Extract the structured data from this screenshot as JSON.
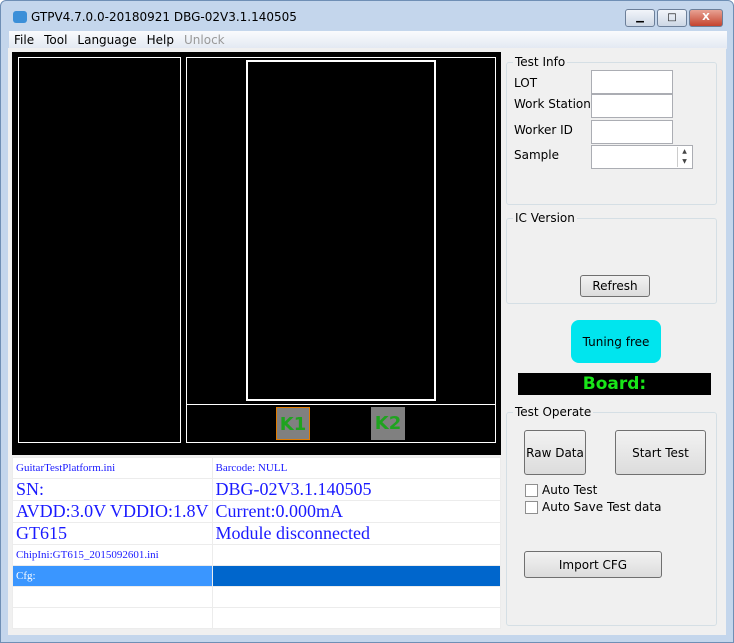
{
  "window": {
    "title": "GTPV4.7.0.0-20180921  DBG-02V3.1.140505",
    "minimize": "▁",
    "maximize": "□",
    "close": "X"
  },
  "menu": [
    "File",
    "Tool",
    "Language",
    "Help",
    "Unlock"
  ],
  "keys": [
    "K1",
    "K2"
  ],
  "test_info": {
    "caption": "Test Info",
    "fields": [
      {
        "label": "LOT",
        "value": ""
      },
      {
        "label": "Work Station",
        "value": ""
      },
      {
        "label": "Worker ID",
        "value": ""
      },
      {
        "label": "Sample",
        "value": ""
      }
    ]
  },
  "ic_version": {
    "caption": "IC Version",
    "refresh": "Refresh"
  },
  "tuning": "Tuning free",
  "board": "Board:",
  "test_operate": {
    "caption": "Test Operate",
    "raw_data": "Raw Data",
    "start_test": "Start Test",
    "auto_test": "Auto Test",
    "auto_save": "Auto Save Test data",
    "import_cfg": "Import CFG"
  },
  "grid": {
    "r0a": "GuitarTestPlatform.ini",
    "r0b": "Barcode: NULL",
    "r1a": "SN:",
    "r1b": "DBG-02V3.1.140505",
    "r2a": "AVDD:3.0V VDDIO:1.8V",
    "r2b": "Current:0.000mA",
    "r3a": "GT615",
    "r3b": "Module disconnected",
    "r4a": "ChipIni:GT615_2015092601.ini",
    "r5a": "Cfg:"
  }
}
